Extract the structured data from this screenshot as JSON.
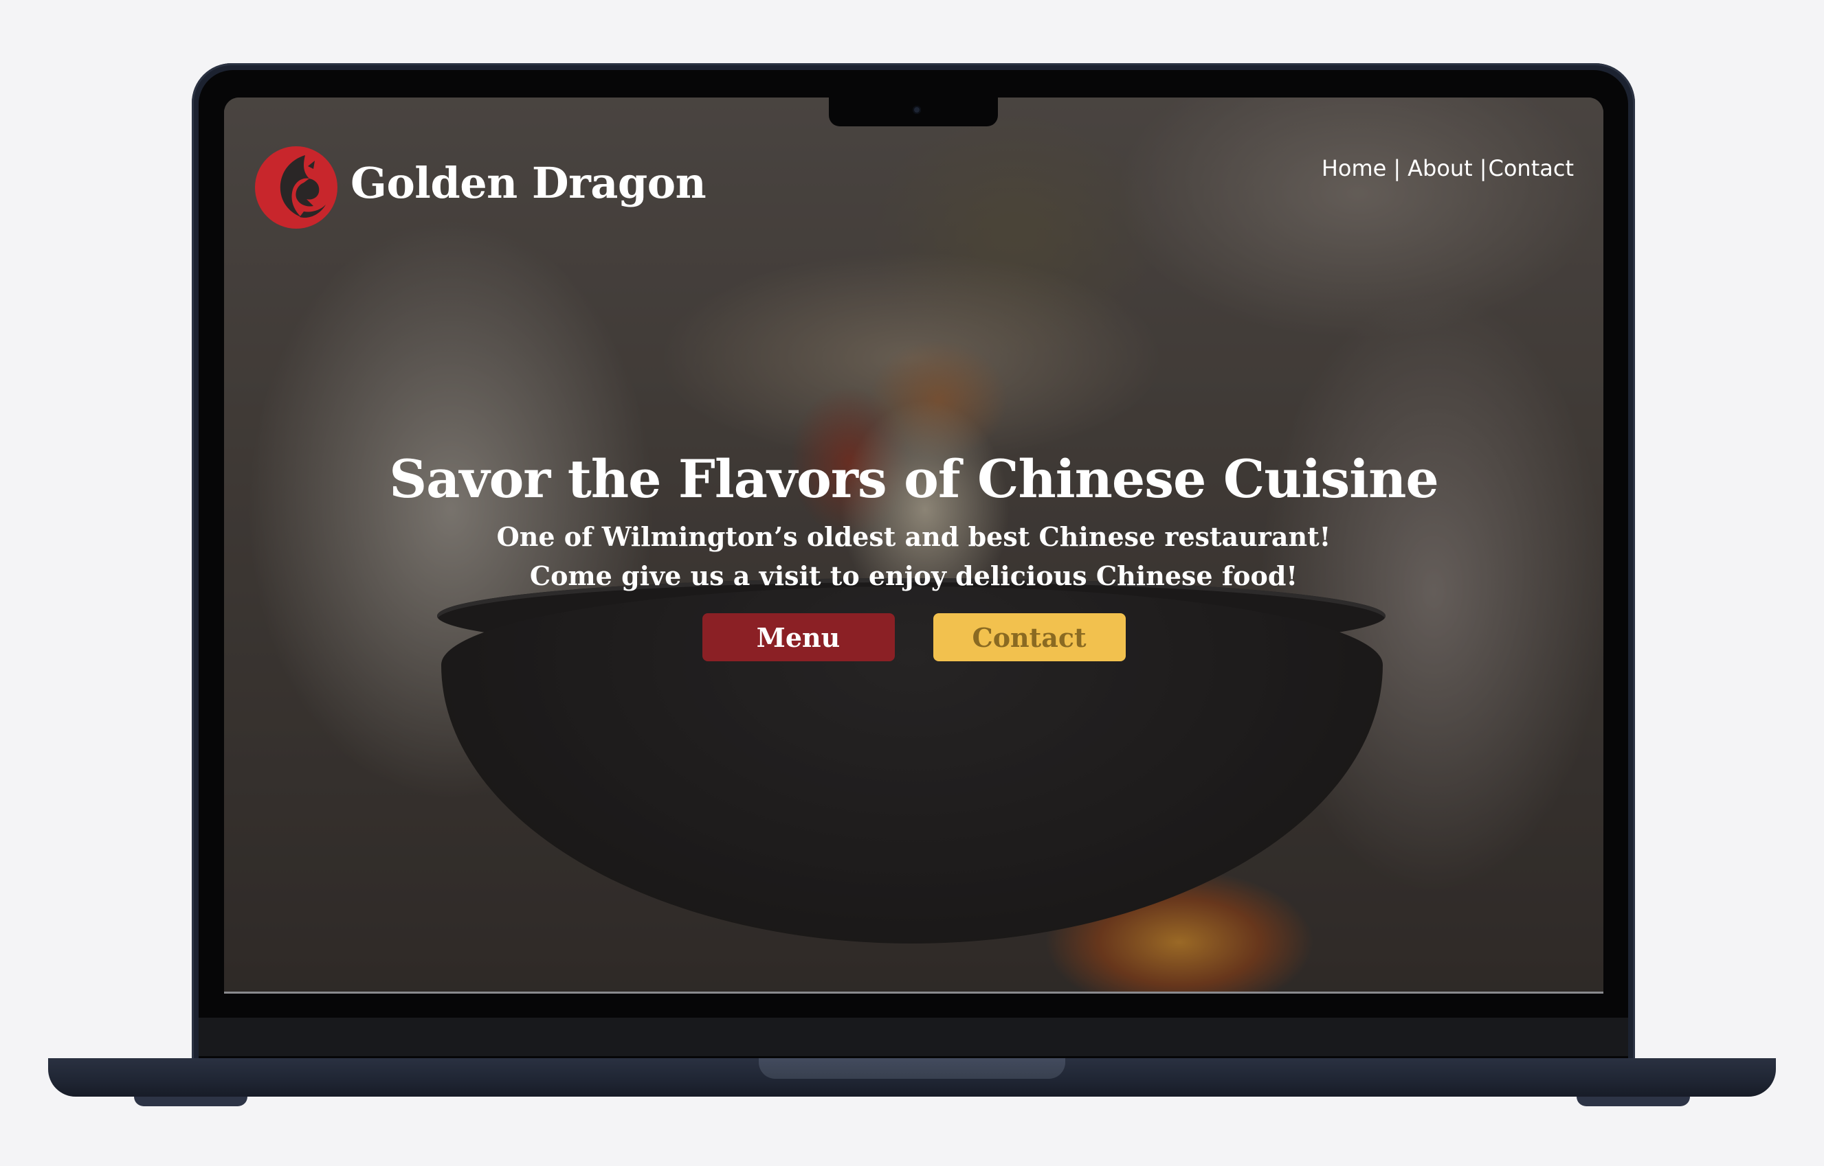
{
  "brand": {
    "name": "Golden Dragon",
    "logo_icon": "dragon-logo-icon",
    "logo_color": "#c8262c"
  },
  "nav": {
    "home": "Home",
    "sep1": "|",
    "about": "About",
    "sep2": "|",
    "contact": "Contact"
  },
  "hero": {
    "title": "Savor the Flavors of Chinese Cuisine",
    "subtitle_line1": "One of Wilmington’s oldest and best Chinese restaurant!",
    "subtitle_line2": "Come give us a visit to enjoy delicious Chinese food!"
  },
  "buttons": {
    "menu_label": "Menu",
    "contact_label": "Contact",
    "menu_color": "#8b2025",
    "contact_color": "#f2c14e"
  }
}
